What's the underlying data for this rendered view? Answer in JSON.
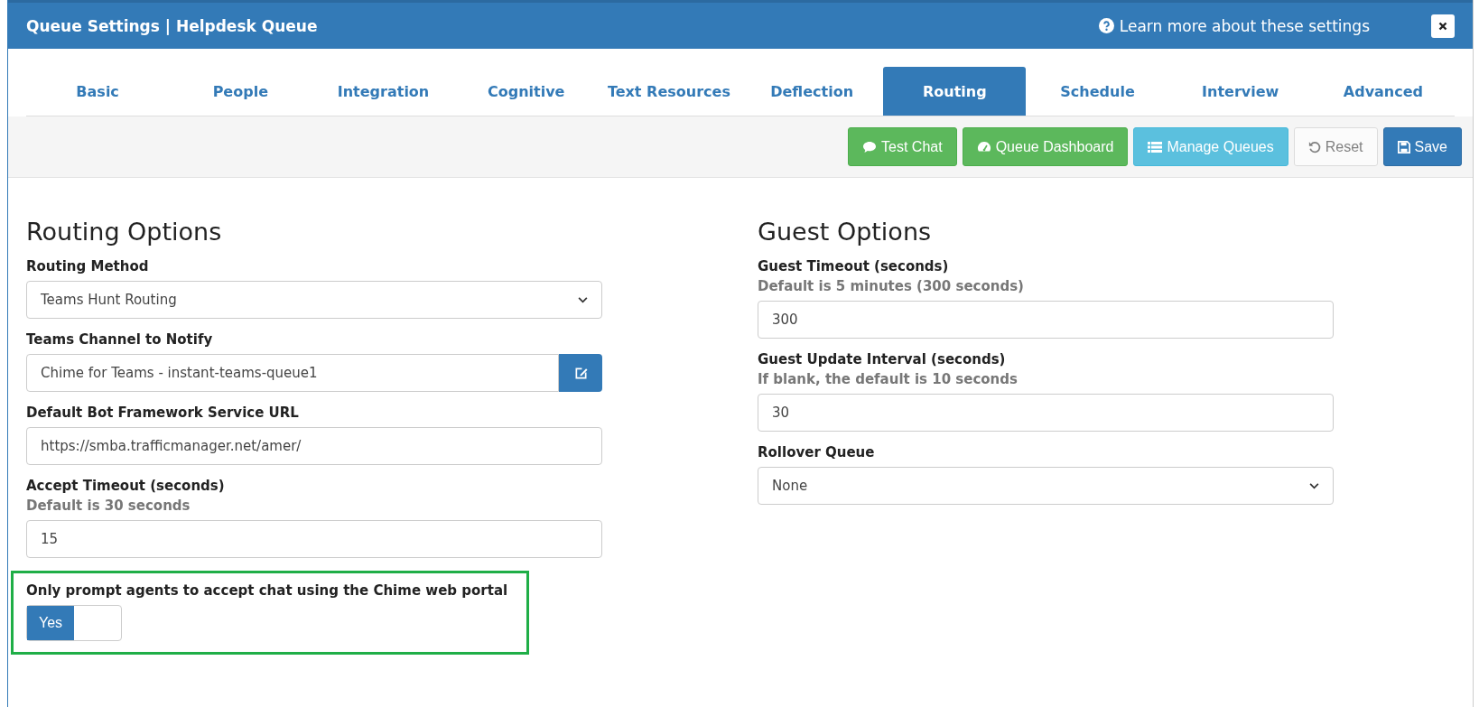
{
  "window": {
    "title": "Queue Settings | Helpdesk Queue",
    "help_link": "Learn more about these settings"
  },
  "tabs": [
    {
      "label": "Basic",
      "selected": false
    },
    {
      "label": "People",
      "selected": false
    },
    {
      "label": "Integration",
      "selected": false
    },
    {
      "label": "Cognitive",
      "selected": false
    },
    {
      "label": "Text Resources",
      "selected": false
    },
    {
      "label": "Deflection",
      "selected": false
    },
    {
      "label": "Routing",
      "selected": true
    },
    {
      "label": "Schedule",
      "selected": false
    },
    {
      "label": "Interview",
      "selected": false
    },
    {
      "label": "Advanced",
      "selected": false
    }
  ],
  "toolbar": [
    {
      "label": "Test Chat",
      "kind": "success",
      "disabled": false
    },
    {
      "label": "Queue Dashboard",
      "kind": "success",
      "disabled": false
    },
    {
      "label": "Manage Queues",
      "kind": "info",
      "disabled": false
    },
    {
      "label": "Reset",
      "kind": "default",
      "disabled": true
    },
    {
      "label": "Save",
      "kind": "primary",
      "disabled": false
    }
  ],
  "routing_options": {
    "title": "Routing Options",
    "fields": [
      {
        "kind": "select",
        "label": "Routing Method",
        "value": "Teams Hunt Routing"
      },
      {
        "kind": "input-button",
        "label": "Teams Channel to Notify",
        "value": "Chime for Teams - instant-teams-queue1"
      },
      {
        "kind": "input",
        "label": "Default Bot Framework Service URL",
        "value": "https://smba.trafficmanager.net/amer/"
      },
      {
        "kind": "input",
        "label": "Accept Timeout (seconds)",
        "hint": "Default is 30 seconds",
        "value": "15"
      },
      {
        "kind": "toggle",
        "label": "Only prompt agents to accept chat using the Chime web portal",
        "on": true,
        "on_label": "Yes",
        "highlighted": true
      }
    ]
  },
  "guest_options": {
    "title": "Guest Options",
    "fields": [
      {
        "kind": "input",
        "label": "Guest Timeout (seconds)",
        "hint": "Default is 5 minutes (300 seconds)",
        "value": "300"
      },
      {
        "kind": "input",
        "label": "Guest Update Interval (seconds)",
        "hint": "If blank, the default is 10 seconds",
        "value": "30"
      },
      {
        "kind": "select",
        "label": "Rollover Queue",
        "value": "None"
      }
    ]
  }
}
